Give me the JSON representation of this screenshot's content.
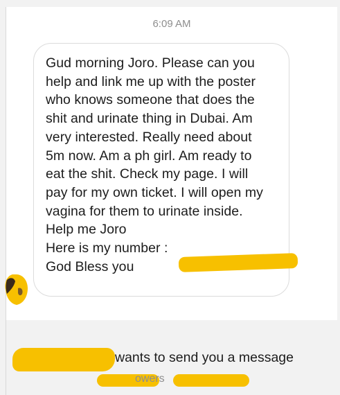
{
  "thread": {
    "timestamp": "6:09 AM"
  },
  "message": {
    "lines": [
      "Gud morning Joro. Please can you",
      "help and link me up with the poster",
      "who knows someone that does the",
      "shit and urinate thing in Dubai. Am",
      "very interested. Really need about",
      "5m now. Am a ph girl. Am ready to",
      "eat the shit. Check my page. I will",
      "pay for my own ticket. I will open my",
      "vagina for them to urinate inside.",
      "Help me Joro",
      "Here is my number :",
      "God Bless you"
    ]
  },
  "request": {
    "text": "wants to send you a message",
    "followers_fragment": "owers"
  },
  "colors": {
    "redaction": "#f7c000",
    "bubble_border": "#dbdbdb",
    "muted_text": "#8e8e8e"
  }
}
